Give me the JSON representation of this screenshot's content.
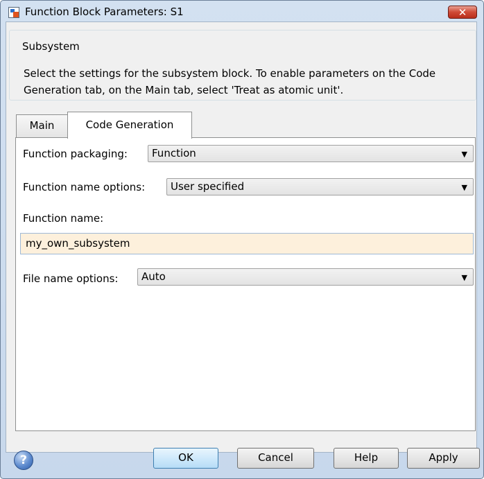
{
  "window": {
    "title": "Function Block Parameters: S1",
    "close_glyph": "✕"
  },
  "subsystem": {
    "legend": "Subsystem",
    "description": "Select the settings for the subsystem block. To enable parameters on the Code Generation tab, on the Main tab, select 'Treat as atomic unit'."
  },
  "tabs": [
    {
      "label": "Main",
      "active": false
    },
    {
      "label": "Code Generation",
      "active": true
    }
  ],
  "fields": {
    "function_packaging": {
      "label": "Function packaging:",
      "value": "Function"
    },
    "function_name_options": {
      "label": "Function name options:",
      "value": "User specified"
    },
    "function_name": {
      "label": "Function name:",
      "value": "my_own_subsystem"
    },
    "file_name_options": {
      "label": "File name options:",
      "value": "Auto"
    }
  },
  "dropdown_glyph": "▼",
  "buttons": {
    "help_icon": "?",
    "ok": "OK",
    "cancel": "Cancel",
    "help": "Help",
    "apply": "Apply"
  },
  "colors": {
    "frame": "#c7d8ec",
    "input_highlight": "#fdf0dc",
    "close_button": "#c9422f"
  }
}
